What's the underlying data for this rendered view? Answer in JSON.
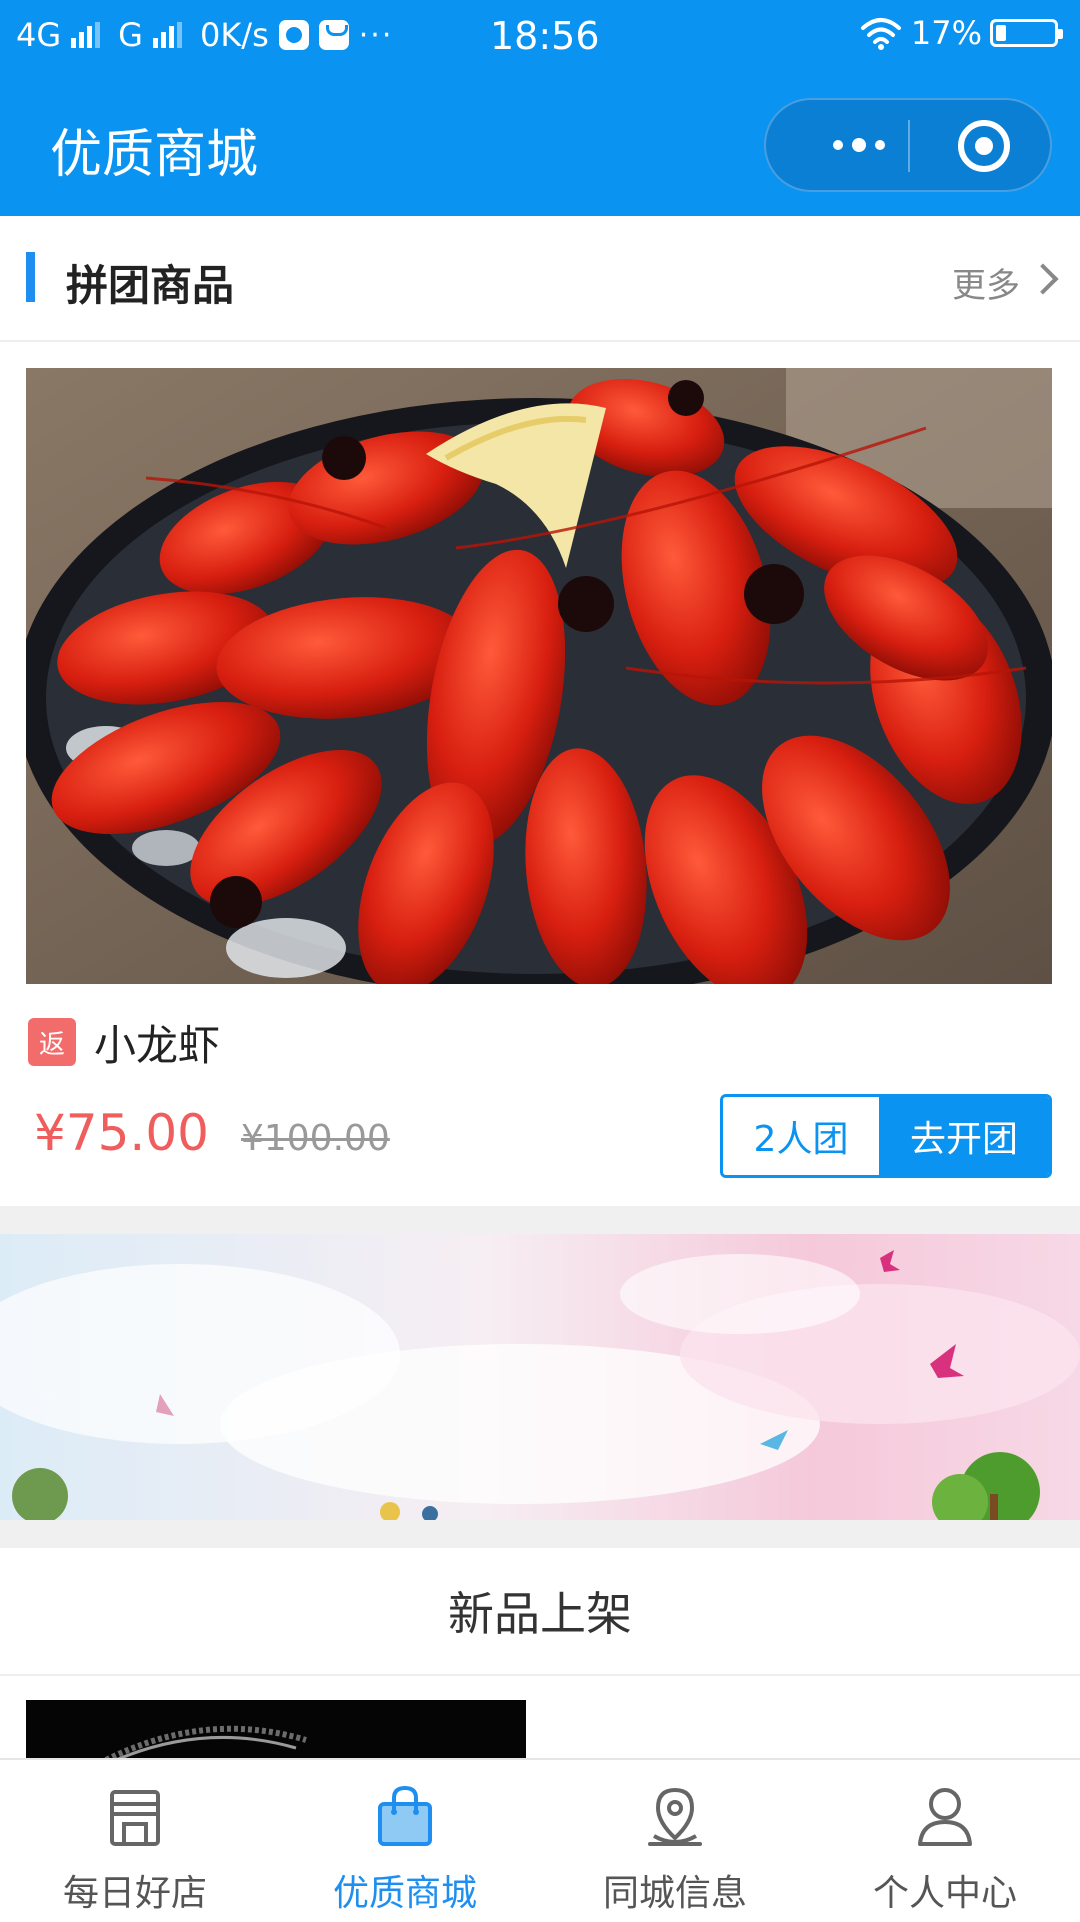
{
  "status_bar": {
    "network1": "4G",
    "network2": "G",
    "speed": "0K/s",
    "more": "···",
    "time": "18:56",
    "battery": "17%",
    "battery_level": 0.17
  },
  "nav": {
    "title": "优质商城"
  },
  "group_section": {
    "title": "拼团商品",
    "more": "更多"
  },
  "product": {
    "badge": "返",
    "name": "小龙虾",
    "price": "¥75.00",
    "original_price": "¥100.00",
    "group_size": "2人团",
    "group_action": "去开团"
  },
  "new_section": {
    "title": "新品上架"
  },
  "tabbar": {
    "tabs": [
      {
        "label": "每日好店",
        "icon": "store-icon",
        "active": false
      },
      {
        "label": "优质商城",
        "icon": "shopping-bag-icon",
        "active": true
      },
      {
        "label": "同城信息",
        "icon": "location-pin-icon",
        "active": false
      },
      {
        "label": "个人中心",
        "icon": "user-icon",
        "active": false
      }
    ]
  },
  "colors": {
    "brand_blue": "#0a93f0",
    "price_red": "#f05d5d",
    "badge_red": "#f26c6c"
  }
}
